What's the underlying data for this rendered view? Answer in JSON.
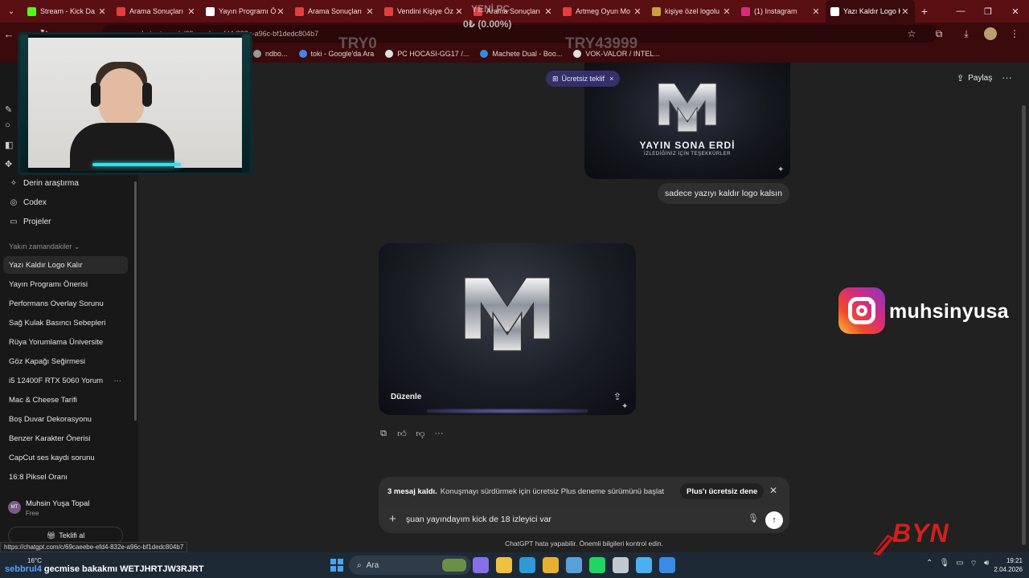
{
  "browser": {
    "tabs": [
      {
        "title": "Stream - Kick Da",
        "favicon_color": "#53fc18",
        "active": false
      },
      {
        "title": "Arama Sonuçları",
        "favicon_color": "#e04040",
        "active": false
      },
      {
        "title": "Yayın Programı Ö",
        "favicon_color": "#ffffff",
        "active": false
      },
      {
        "title": "Arama Sonuçları",
        "favicon_color": "#e04040",
        "active": false
      },
      {
        "title": "Vendini Kişiye Öz",
        "favicon_color": "#e04040",
        "active": false
      },
      {
        "title": "Arama Sonuçları",
        "favicon_color": "#e04040",
        "active": false
      },
      {
        "title": "Artmeg Oyun Mo",
        "favicon_color": "#e04040",
        "active": false
      },
      {
        "title": "kişiye özel logolu",
        "favicon_color": "#c8a040",
        "active": false
      },
      {
        "title": "(1) Instagram",
        "favicon_color": "#d72c7a",
        "active": false
      },
      {
        "title": "Yazı Kaldır Logo K",
        "favicon_color": "#ffffff",
        "active": true
      }
    ],
    "new_tab": "+",
    "url": "chatgpt.com/c/69caeebe-efd4-832e-a96c-bf1dedc804b7",
    "bookmarks": [
      {
        "label": "ndbo...",
        "color": "#999999"
      },
      {
        "label": "toki - Google'da Ara",
        "color": "#4285f4"
      },
      {
        "label": "PC HOCASI-GG17 /...",
        "color": "#e0e0e0"
      },
      {
        "label": "Machete Dual - Boo...",
        "color": "#3a8ad8"
      },
      {
        "label": "VOK-VALOR / INTEL...",
        "color": "#e0e0e0"
      }
    ],
    "status_url": "https://chatgpt.com/c/69caeebe-efd4-832e-a96c-bf1dedc804b7"
  },
  "stream_overlay": {
    "title": "YENİ PC",
    "progress_text": "0₺ (0.00%)",
    "min_label": "TRY0",
    "max_label": "TRY43999",
    "instagram_handle": "muhsinyusa",
    "logo_text": "BYN",
    "ticker_prefix": "sebbrul4",
    "ticker_text": "gecmise bakakmı WETJHRTJW3RJRT"
  },
  "sidebar": {
    "items": [
      {
        "label": "Derin araştırma",
        "icon": "telescope-icon"
      },
      {
        "label": "Codex",
        "icon": "codex-icon"
      },
      {
        "label": "Projeler",
        "icon": "folder-icon"
      }
    ],
    "section_title": "Yakın zamandakiler",
    "chats": [
      {
        "label": "Yazı Kaldır Logo Kalır",
        "active": true
      },
      {
        "label": "Yayın Programı Önerisi",
        "active": false
      },
      {
        "label": "Performans Overlay Sorunu",
        "active": false
      },
      {
        "label": "Sağ Kulak Basıncı Sebepleri",
        "active": false
      },
      {
        "label": "Rüya Yorumlama Üniversite",
        "active": false
      },
      {
        "label": "Göz Kapağı Seğirmesi",
        "active": false
      },
      {
        "label": "i5 12400F RTX 5060 Yorum",
        "active": false
      },
      {
        "label": "Mac & Cheese Tarifi",
        "active": false
      },
      {
        "label": "Boş Duvar Dekorasyonu",
        "active": false
      },
      {
        "label": "Benzer Karakter Önerisi",
        "active": false
      },
      {
        "label": "CapCut ses kaydı sorunu",
        "active": false
      },
      {
        "label": "16:8 Piksel Oranı",
        "active": false
      }
    ],
    "user": {
      "initials": "MT",
      "name": "Muhsin Yuşa Topal",
      "plan": "Free"
    },
    "gift_button": "Teklifi al"
  },
  "main": {
    "share_label": "Paylaş",
    "free_offer_pill": "Ücretsiz teklif",
    "image1": {
      "line1": "YAYIN SONA ERDİ",
      "line2": "İZLEDİĞİNİZ İÇİN TEŞEKKÜRLER"
    },
    "user_message": "sadece yazıyı kaldır logo kalsın",
    "image2": {
      "edit_label": "Düzenle"
    },
    "limit_banner": {
      "bold": "3 mesaj kaldı.",
      "text": "Konuşmayı sürdürmek için ücretsiz Plus deneme sürümünü başlat",
      "button": "Plus'ı ücretsiz dene"
    },
    "composer_text": "şuan yayındayım kick de 18 izleyici var",
    "disclaimer": "ChatGPT hata yapabilir. Önemli bilgileri kontrol edin."
  },
  "taskbar": {
    "weather_temp": "16°C",
    "search_placeholder": "Ara",
    "time": "19:21",
    "date": "2.04.2026",
    "apps": [
      {
        "name": "copilot-icon",
        "color": "#8a6ee8"
      },
      {
        "name": "file-explorer-icon",
        "color": "#f0c040"
      },
      {
        "name": "edge-icon",
        "color": "#2e9ad8"
      },
      {
        "name": "chrome-icon",
        "color": "#e8b030"
      },
      {
        "name": "app-window-icon",
        "color": "#5aa0d8"
      },
      {
        "name": "spotify-icon",
        "color": "#1ed760"
      },
      {
        "name": "steam-icon",
        "color": "#c0c8d0"
      },
      {
        "name": "app-diamond-icon",
        "color": "#4ab0f0"
      },
      {
        "name": "app-edit-icon",
        "color": "#3a8ae8"
      }
    ]
  }
}
